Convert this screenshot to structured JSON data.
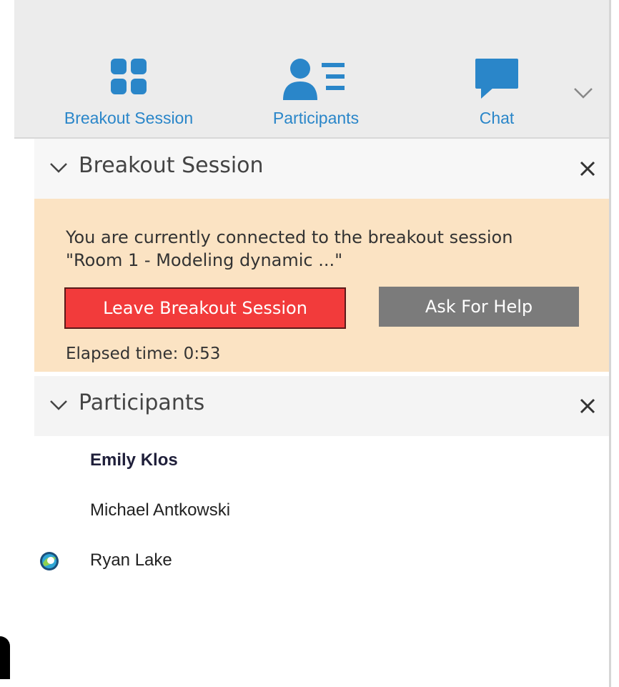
{
  "toolbar": {
    "items": [
      {
        "label": "Breakout Session",
        "icon": "breakout-grid-icon"
      },
      {
        "label": "Participants",
        "icon": "participants-icon"
      },
      {
        "label": "Chat",
        "icon": "chat-bubble-icon"
      }
    ],
    "more_icon": "chevron-down-icon",
    "accent_color": "#2a86c9"
  },
  "breakout_panel": {
    "title": "Breakout Session",
    "message": "You are currently connected to the breakout session\n\"Room 1 - Modeling dynamic ...\"",
    "leave_label": "Leave Breakout Session",
    "help_label": "Ask For Help",
    "elapsed": "Elapsed time: 0:53",
    "leave_color": "#f23b3b",
    "notice_color": "#fbe3c3"
  },
  "participants_panel": {
    "title": "Participants",
    "items": [
      {
        "name": "Emily Klos",
        "role": "host"
      },
      {
        "name": "Michael Antkowski",
        "role": "attendee"
      },
      {
        "name": "Ryan Lake",
        "role": "presenter"
      }
    ]
  }
}
